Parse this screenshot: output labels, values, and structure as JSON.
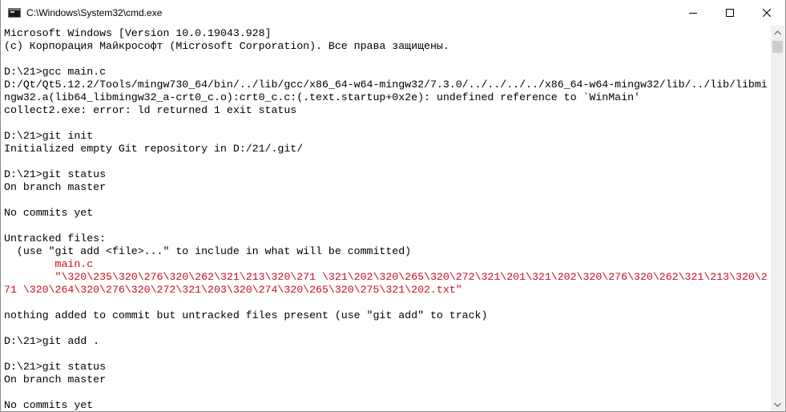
{
  "window": {
    "title": "C:\\Windows\\System32\\cmd.exe",
    "icon": "cmd-console-icon",
    "buttons": [
      "minimize-icon",
      "maximize-icon",
      "close-icon"
    ]
  },
  "console": {
    "lines": [
      {
        "text": "Microsoft Windows [Version 10.0.19043.928]"
      },
      {
        "text": "(c) Корпорация Майкрософт (Microsoft Corporation). Все права защищены."
      },
      {
        "text": ""
      },
      {
        "text": "D:\\21>gcc main.c"
      },
      {
        "text": "D:/Qt/Qt5.12.2/Tools/mingw730_64/bin/../lib/gcc/x86_64-w64-mingw32/7.3.0/../../../../x86_64-w64-mingw32/lib/../lib/libmi"
      },
      {
        "text": "ngw32.a(lib64_libmingw32_a-crt0_c.o):crt0_c.c:(.text.startup+0x2e): undefined reference to `WinMain'"
      },
      {
        "text": "collect2.exe: error: ld returned 1 exit status"
      },
      {
        "text": ""
      },
      {
        "text": "D:\\21>git init"
      },
      {
        "text": "Initialized empty Git repository in D:/21/.git/"
      },
      {
        "text": ""
      },
      {
        "text": "D:\\21>git status"
      },
      {
        "text": "On branch master"
      },
      {
        "text": ""
      },
      {
        "text": "No commits yet"
      },
      {
        "text": ""
      },
      {
        "text": "Untracked files:"
      },
      {
        "text": "  (use \"git add <file>...\" to include in what will be committed)"
      },
      {
        "text": "        main.c",
        "color": "#c50f1f"
      },
      {
        "text": "        \"\\320\\235\\320\\276\\320\\262\\321\\213\\320\\271 \\321\\202\\320\\265\\320\\272\\321\\201\\321\\202\\320\\276\\320\\262\\321\\213\\320\\2",
        "color": "#c50f1f"
      },
      {
        "text": "71 \\320\\264\\320\\276\\320\\272\\321\\203\\320\\274\\320\\265\\320\\275\\321\\202.txt\"",
        "color": "#c50f1f"
      },
      {
        "text": ""
      },
      {
        "text": "nothing added to commit but untracked files present (use \"git add\" to track)"
      },
      {
        "text": ""
      },
      {
        "text": "D:\\21>git add ."
      },
      {
        "text": ""
      },
      {
        "text": "D:\\21>git status"
      },
      {
        "text": "On branch master"
      },
      {
        "text": ""
      },
      {
        "text": "No commits yet"
      }
    ]
  },
  "colors": {
    "console_bg": "#ffffff",
    "console_text": "#000000",
    "untracked_text": "#c50f1f",
    "scrollbar_track": "#f0f0f0",
    "scrollbar_thumb": "#cdcdcd"
  }
}
